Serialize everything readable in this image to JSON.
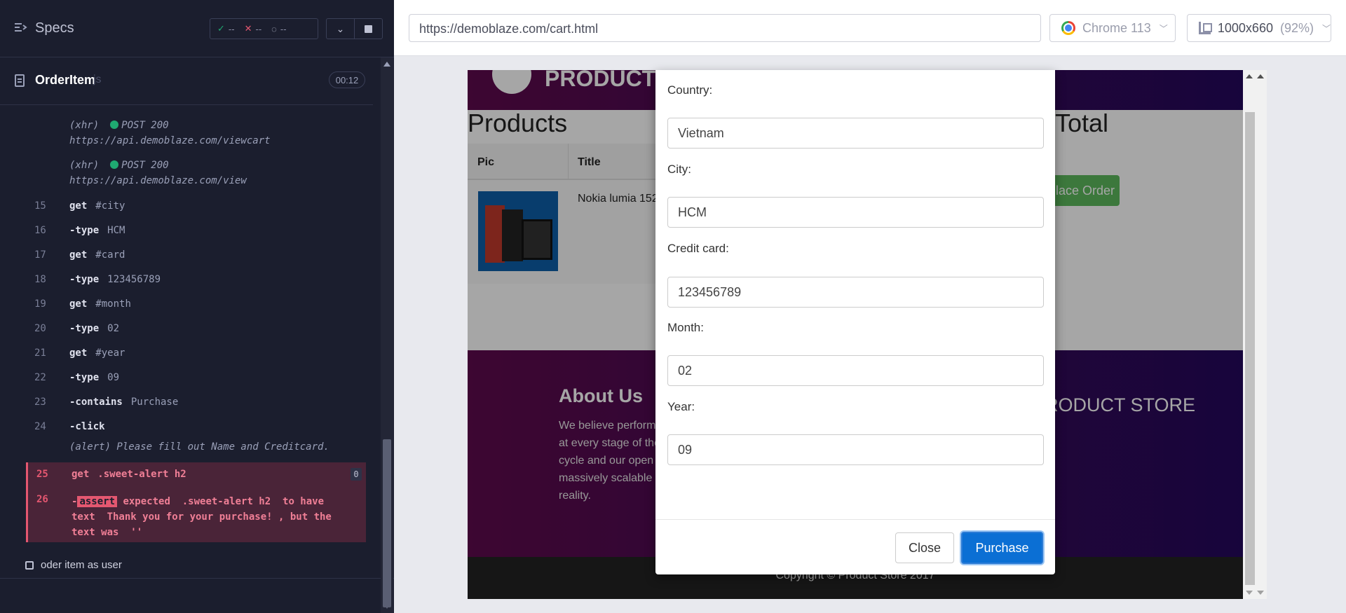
{
  "reporter": {
    "title": "Specs",
    "stats": {
      "passed": "--",
      "failed": "--",
      "pending": "--"
    },
    "spec": {
      "name": "OrderItem",
      "ext": "js",
      "time": "00:12"
    },
    "xhr": [
      {
        "type": "(xhr)",
        "status": "POST 200",
        "url": "https://api.demoblaze.com/viewcart"
      },
      {
        "type": "(xhr)",
        "status": "POST 200",
        "url": "https://api.demoblaze.com/view"
      }
    ],
    "commands": [
      {
        "num": "15",
        "name": "get",
        "arg": "#city"
      },
      {
        "num": "16",
        "name": "-type",
        "arg": "HCM"
      },
      {
        "num": "17",
        "name": "get",
        "arg": "#card"
      },
      {
        "num": "18",
        "name": "-type",
        "arg": "123456789"
      },
      {
        "num": "19",
        "name": "get",
        "arg": "#month"
      },
      {
        "num": "20",
        "name": "-type",
        "arg": "02"
      },
      {
        "num": "21",
        "name": "get",
        "arg": "#year"
      },
      {
        "num": "22",
        "name": "-type",
        "arg": "09"
      },
      {
        "num": "23",
        "name": "-contains",
        "arg": "Purchase"
      },
      {
        "num": "24",
        "name": "-click",
        "arg": ""
      }
    ],
    "alert": "(alert)  Please fill out Name and Creditcard.",
    "failed": {
      "cmd25_num": "25",
      "cmd25_name": "get",
      "cmd25_arg": ".sweet-alert h2",
      "cmd25_badge": "0",
      "cmd26_num": "26",
      "cmd26_prefix": "-",
      "cmd26_badge": "assert",
      "cmd26_line1": " expected  .sweet-alert h2  to have",
      "cmd26_line2": "text  Thank you for your purchase! , but the",
      "cmd26_line3": "text was  ''"
    },
    "other_test": "oder item as user"
  },
  "aut": {
    "url": "https://demoblaze.com/cart.html",
    "browser": "Chrome 113",
    "viewport": "1000x660",
    "zoom": "(92%)"
  },
  "site": {
    "products_heading": "Products",
    "total_heading": "Total",
    "col_pic": "Pic",
    "col_title": "Title",
    "item_title": "Nokia lumia 1520",
    "order_btn": "Place Order",
    "about_heading": "About Us",
    "about_text": "We believe performance needs to be validated at every stage of the software development cycle and our open source compatible, massively scalable platform makes that a reality.",
    "store_heading": "PRODUCT STORE",
    "copyright": "Copyright © Product Store 2017"
  },
  "modal": {
    "fields": [
      {
        "label": "Country:",
        "value": "Vietnam"
      },
      {
        "label": "City:",
        "value": "HCM"
      },
      {
        "label": "Credit card:",
        "value": "123456789"
      },
      {
        "label": "Month:",
        "value": "02"
      },
      {
        "label": "Year:",
        "value": "09"
      }
    ],
    "close_btn": "Close",
    "purchase_btn": "Purchase"
  }
}
